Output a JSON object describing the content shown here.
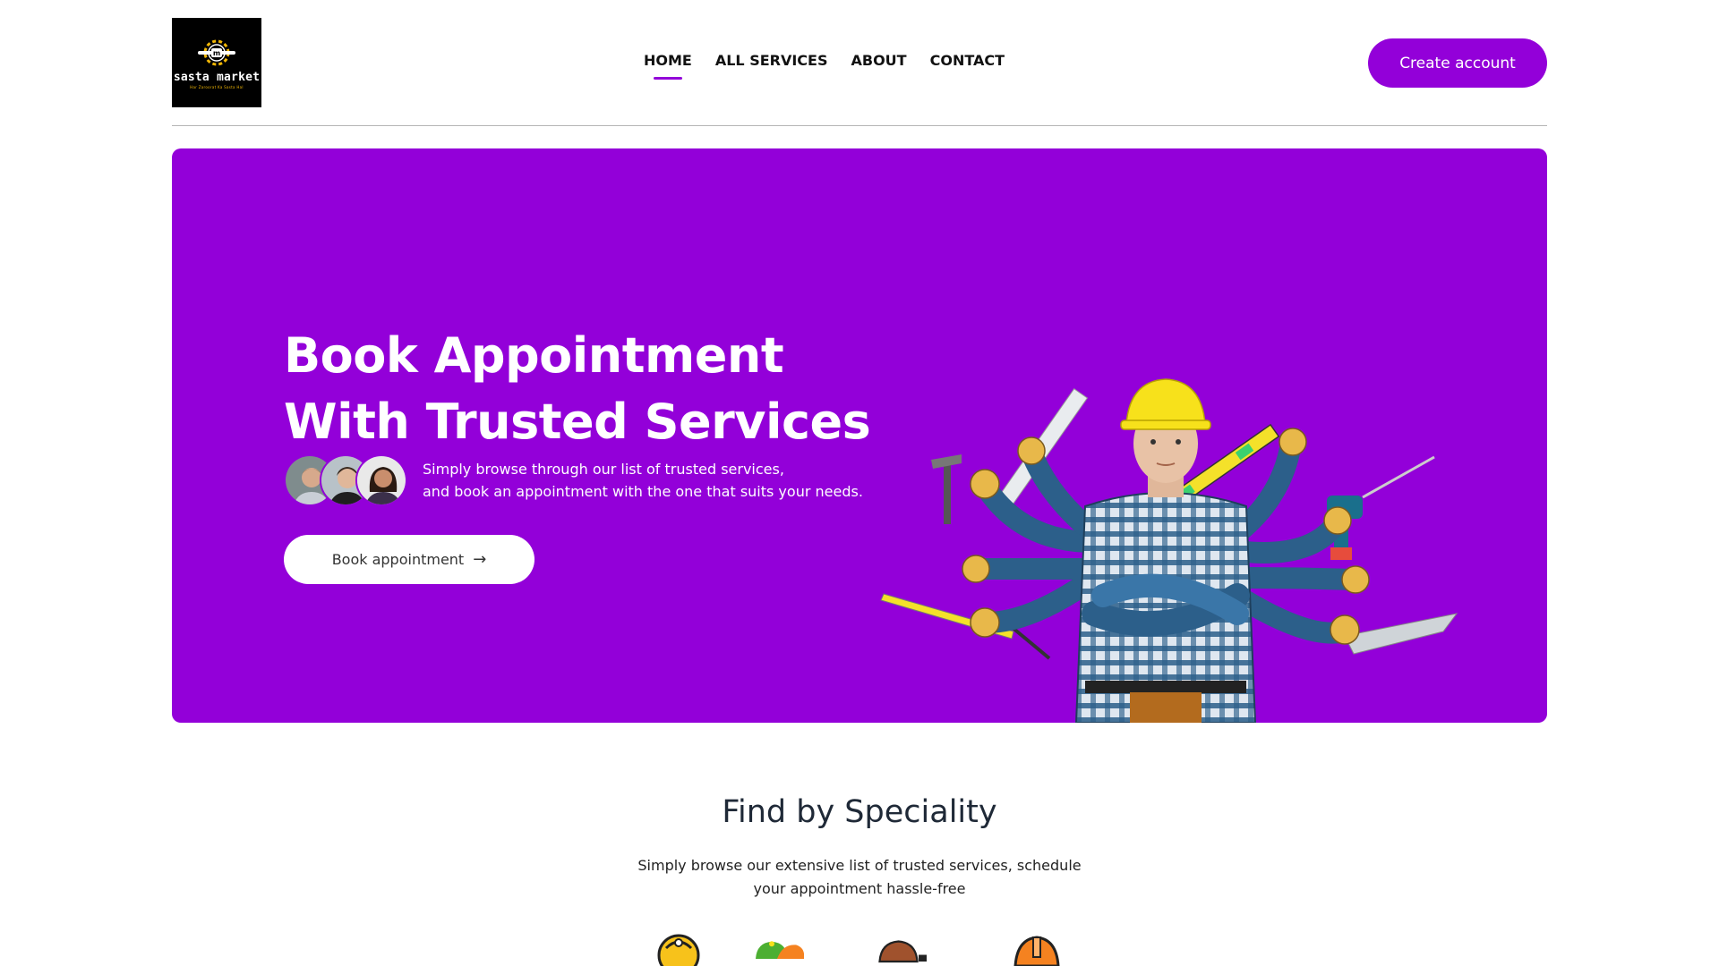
{
  "brand": {
    "name": "sasta market",
    "tagline": "Har Zaroorat Ka Sasta Hal"
  },
  "nav": {
    "links": [
      {
        "label": "HOME",
        "active": true
      },
      {
        "label": "ALL SERVICES",
        "active": false
      },
      {
        "label": "ABOUT",
        "active": false
      },
      {
        "label": "CONTACT",
        "active": false
      }
    ],
    "cta_label": "Create account"
  },
  "hero": {
    "title_line1": "Book Appointment",
    "title_line2": "With Trusted Services",
    "subtitle_line1": "Simply browse through our list of trusted services,",
    "subtitle_line2": "and book an appointment with the one that suits your needs.",
    "button_label": "Book appointment",
    "button_icon": "arrow-right-icon"
  },
  "speciality": {
    "title": "Find by Speciality",
    "subtitle": "Simply browse our extensive list of trusted services, schedule your appointment hassle-free",
    "icons": [
      "worker-yellow-icon",
      "worker-green-orange-icon",
      "worker-brown-icon",
      "worker-orange-helmet-icon"
    ]
  },
  "colors": {
    "accent": "#9300d9",
    "hero_bg": "#9300d9",
    "logo_bg": "#000000",
    "logo_accent": "#f2b705"
  }
}
